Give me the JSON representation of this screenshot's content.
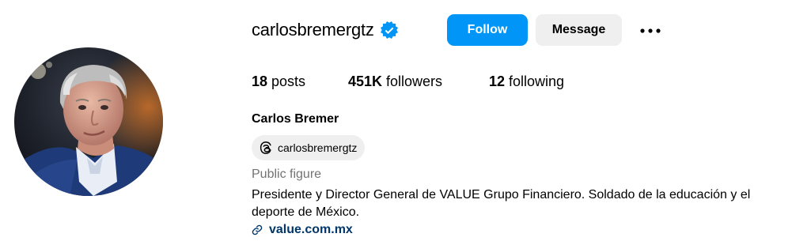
{
  "profile": {
    "username": "carlosbremergtz",
    "verified": true,
    "full_name": "Carlos Bremer",
    "threads_handle": "carlosbremergtz",
    "category": "Public figure",
    "bio": "Presidente y Director General de VALUE Grupo Financiero. Soldado de la educación y el deporte de México.",
    "link": "value.com.mx"
  },
  "actions": {
    "follow_label": "Follow",
    "message_label": "Message",
    "more_icon": "more-horizontal-icon"
  },
  "stats": {
    "posts_count": "18",
    "posts_label": "posts",
    "followers_count": "451K",
    "followers_label": "followers",
    "following_count": "12",
    "following_label": "following"
  },
  "colors": {
    "follow_button": "#0095f6",
    "message_button": "#efefef",
    "verified_badge": "#0095f6",
    "link": "#00376b",
    "category_text": "#737373"
  }
}
